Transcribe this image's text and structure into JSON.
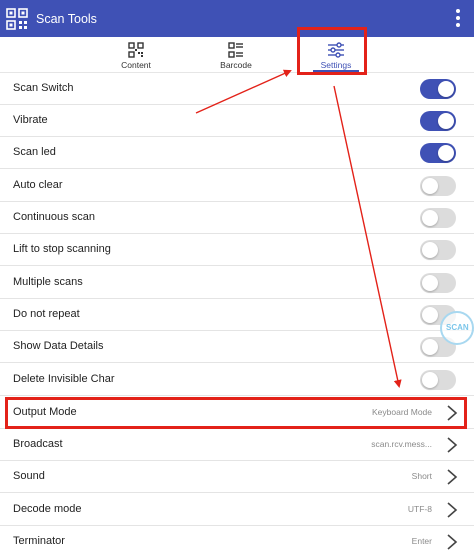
{
  "app": {
    "title": "Scan Tools"
  },
  "tabs": [
    {
      "label": "Content",
      "icon": "qr-code-icon"
    },
    {
      "label": "Barcode",
      "icon": "grid-list-icon"
    },
    {
      "label": "Settings",
      "icon": "sliders-icon",
      "active": true
    }
  ],
  "settings": {
    "toggles": [
      {
        "label": "Scan Switch",
        "on": true
      },
      {
        "label": "Vibrate",
        "on": true
      },
      {
        "label": "Scan led",
        "on": true
      },
      {
        "label": "Auto clear",
        "on": false
      },
      {
        "label": "Continuous scan",
        "on": false
      },
      {
        "label": "Lift to stop scanning",
        "on": false
      },
      {
        "label": "Multiple scans",
        "on": false
      },
      {
        "label": "Do not repeat",
        "on": false
      },
      {
        "label": "Show Data Details",
        "on": false
      },
      {
        "label": "Delete Invisible Char",
        "on": false
      }
    ],
    "options": [
      {
        "label": "Output Mode",
        "value": "Keyboard Mode"
      },
      {
        "label": "Broadcast",
        "value": "scan.rcv.mess..."
      },
      {
        "label": "Sound",
        "value": "Short"
      },
      {
        "label": "Decode mode",
        "value": "UTF-8"
      },
      {
        "label": "Terminator",
        "value": "Enter"
      }
    ]
  },
  "floating_badge": {
    "text": "SCAN"
  },
  "colors": {
    "primary": "#3f51b5",
    "switch_off": "#dcdcdc",
    "annotation": "#e32219"
  }
}
